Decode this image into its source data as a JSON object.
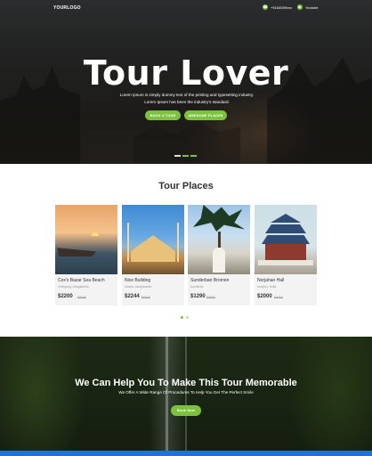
{
  "header": {
    "logo": "YOURLOGO",
    "phone": "+9164059xxx",
    "youtube": "Youtube"
  },
  "hero": {
    "title": "Tour Lover",
    "subtitle": "Lorem Ipsum is simply dummy text of the printing and typesetting industry. Lorem Ipsum has been the industry's standard.",
    "book_button": "BOOK A TOUR",
    "awesome_button": "AWESOME PLACES"
  },
  "places": {
    "title": "Tour Places",
    "cards": [
      {
        "name": "Cox's Bazar Sea Beach",
        "location": "chittgong, bangladesh",
        "price": "$2200",
        "old_price": "$3000"
      },
      {
        "name": "Nice Building",
        "location": "dhaka, bangladesh",
        "price": "$2244",
        "old_price": "$3000"
      },
      {
        "name": "Sunderban Bromon",
        "location": "kuchitrek",
        "price": "$1290",
        "old_price": "$2000"
      },
      {
        "name": "Norjahan Hall",
        "location": "noojher, india",
        "price": "$2000",
        "old_price": "$3000"
      }
    ]
  },
  "cta": {
    "title": "We Can Help You To Make This Tour Memorable",
    "subtitle": "We Offer A Wide Range Of Procedures To Help You Get The Perfect Smile",
    "button": "Book Now"
  },
  "colors": {
    "accent": "#7cc23f",
    "bottom_bar": "#1f6fe8"
  }
}
